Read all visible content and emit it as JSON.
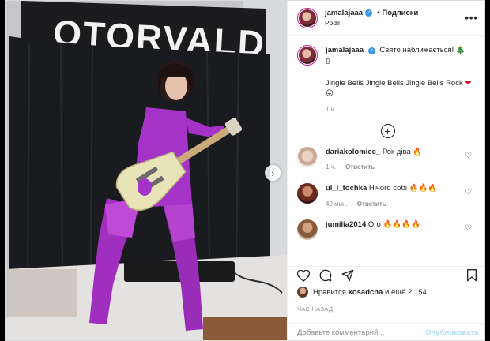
{
  "header": {
    "username": "jamalajaaa",
    "dot": "•",
    "follow_label": "Подписки",
    "location": "Podil",
    "more_label": "•••"
  },
  "photo": {
    "banner_text": "OTORVALD"
  },
  "caption": {
    "username": "jamalajaaa",
    "text_line1": "Свято наближається!",
    "tree": "🎄",
    "text_line1_extra": "▯",
    "text_body": "Jingle Bells Jingle Bells Jingle Bells Rock",
    "heart": "❤",
    "smile": "😛",
    "time": "1 ч."
  },
  "load_more": "+",
  "comments": [
    {
      "username": "dariakolomiec_",
      "text": "Рок діва",
      "emoji": "🔥",
      "time": "1 ч.",
      "reply": "Ответить"
    },
    {
      "username": "ul_i_tochka",
      "text": "Нічого собі",
      "emoji": "🔥🔥🔥",
      "time": "49 мин.",
      "reply": "Ответить"
    },
    {
      "username": "jumilia2014",
      "text": "Ого",
      "emoji": "🔥🔥🔥🔥",
      "time": "",
      "reply": ""
    }
  ],
  "likes": {
    "prefix": "Нравится",
    "user": "kosadcha",
    "suffix": "и ещё 2 154"
  },
  "timeago": "ЧАС НАЗАД",
  "add_comment": {
    "placeholder": "Добавьте комментарий...",
    "publish_label": "Опубликовать"
  },
  "colors": {
    "verified": "#3897f0",
    "publish_disabled": "#b2dffc",
    "outfit": "#a533c8"
  },
  "icons": [
    "heart-icon",
    "comment-icon",
    "share-icon",
    "bookmark-icon",
    "more-icon",
    "next-arrow-icon",
    "plus-circle-icon"
  ]
}
